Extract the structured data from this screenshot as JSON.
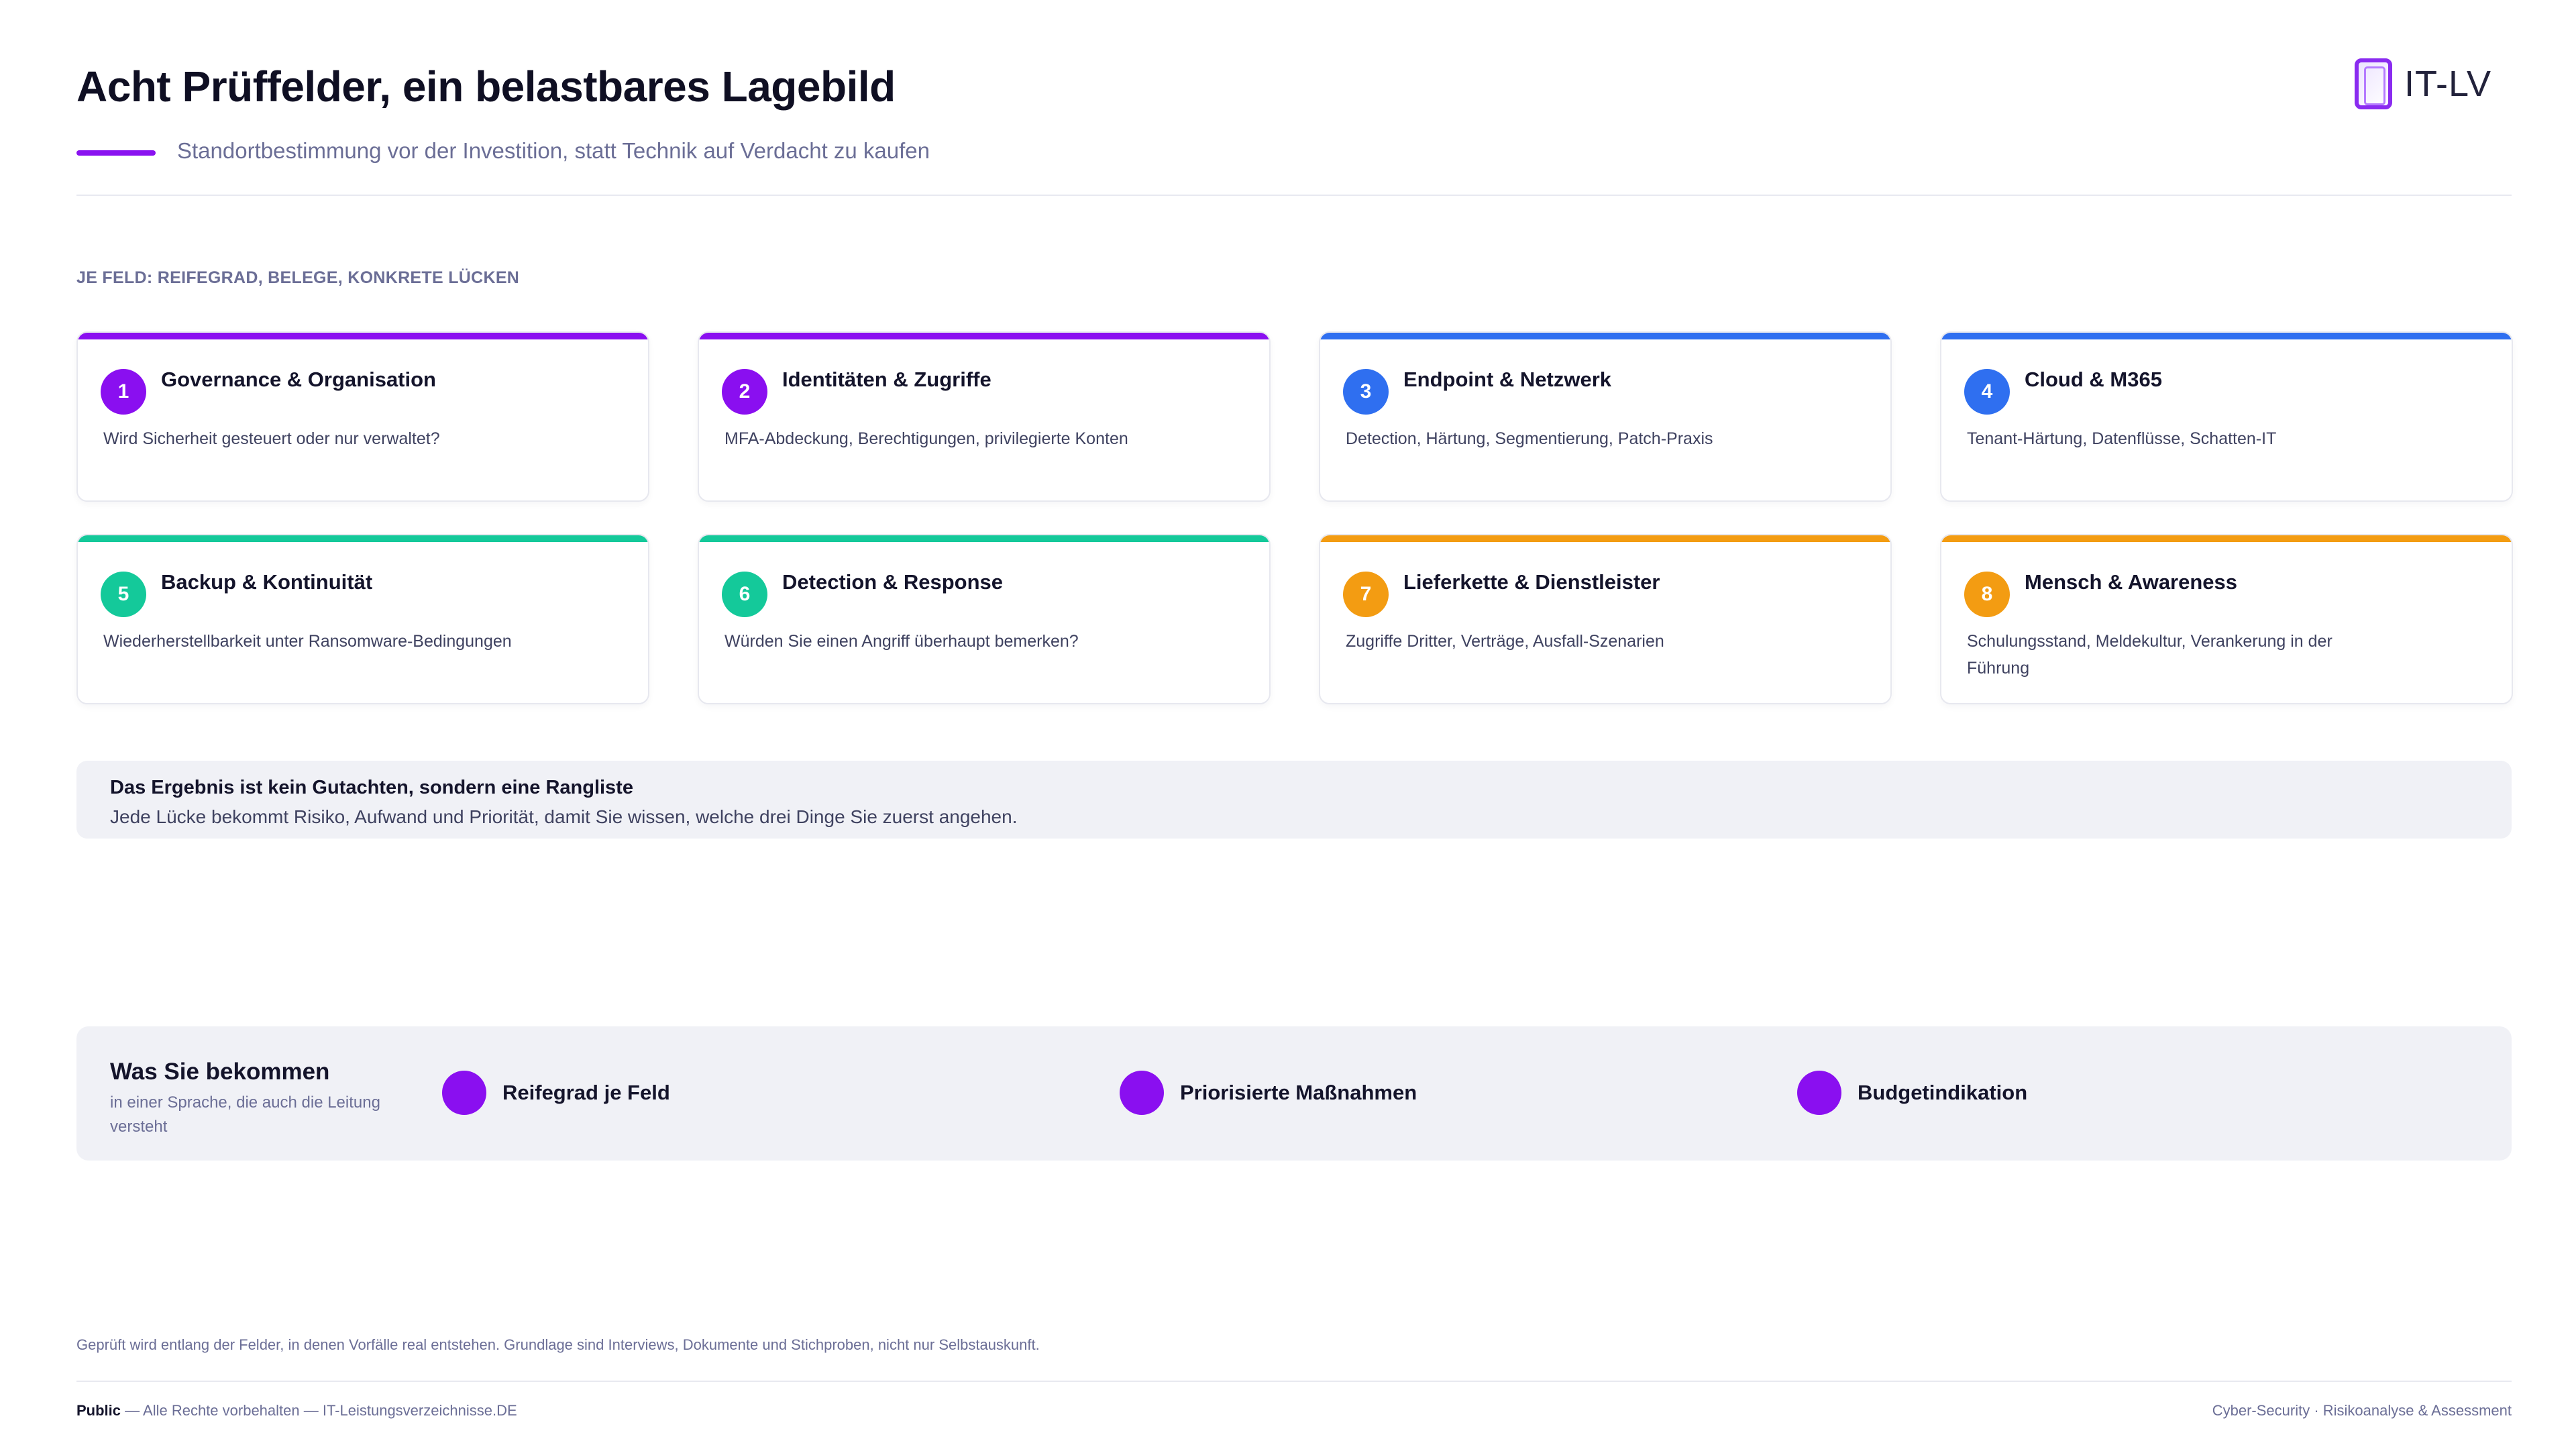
{
  "header": {
    "title": "Acht Prüffelder, ein belastbares Lagebild",
    "subtitle": "Standortbestimmung vor der Investition, statt Technik auf Verdacht zu kaufen",
    "logo_text": "IT-LV",
    "accent_color": "#8a12f0"
  },
  "section_label": "JE FELD: REIFEGRAD, BELEGE, KONKRETE LÜCKEN",
  "cards": [
    {
      "number": "1",
      "title": "Governance & Organisation",
      "text": "Wird Sicherheit gesteuert oder nur verwaltet?",
      "color": "#8a0ff0"
    },
    {
      "number": "2",
      "title": "Identitäten & Zugriffe",
      "text": "MFA-Abdeckung, Berechtigungen, privilegierte Konten",
      "color": "#8a0ff0"
    },
    {
      "number": "3",
      "title": "Endpoint & Netzwerk",
      "text": "Detection, Härtung, Segmentierung, Patch-Praxis",
      "color": "#2f6ff0"
    },
    {
      "number": "4",
      "title": "Cloud & M365",
      "text": "Tenant-Härtung, Datenflüsse, Schatten-IT",
      "color": "#2f6ff0"
    },
    {
      "number": "5",
      "title": "Backup & Kontinuität",
      "text": "Wiederherstellbarkeit unter Ransomware-Bedingungen",
      "color": "#14c99a"
    },
    {
      "number": "6",
      "title": "Detection & Response",
      "text": "Würden Sie einen Angriff überhaupt bemerken?",
      "color": "#14c99a"
    },
    {
      "number": "7",
      "title": "Lieferkette & Dienstleister",
      "text": "Zugriffe Dritter, Verträge, Ausfall-Szenarien",
      "color": "#f39c12"
    },
    {
      "number": "8",
      "title": "Mensch & Awareness",
      "text": "Schulungsstand, Meldekultur, Verankerung in der Führung",
      "color": "#f39c12"
    }
  ],
  "result": {
    "title": "Das Ergebnis ist kein Gutachten, sondern eine Rangliste",
    "text": "Jede Lücke bekommt Risiko, Aufwand und Priorität, damit Sie wissen, welche drei Dinge Sie zuerst angehen."
  },
  "benefits": {
    "title": "Was Sie bekommen",
    "subtitle": "in einer Sprache, die auch die Leitung versteht",
    "items": [
      {
        "label": "Reifegrad je Feld"
      },
      {
        "label": "Priorisierte Maßnahmen"
      },
      {
        "label": "Budgetindikation"
      }
    ]
  },
  "footer": {
    "note": "Geprüft wird entlang der Felder, in denen Vorfälle real entstehen. Grundlage sind Interviews, Dokumente und Stichproben, nicht nur Selbstauskunft.",
    "classification": "Public",
    "rights": " — Alle Rechte vorbehalten — IT-Leistungsverzeichnisse.DE",
    "topic": "Cyber-Security · Risikoanalyse & Assessment"
  }
}
